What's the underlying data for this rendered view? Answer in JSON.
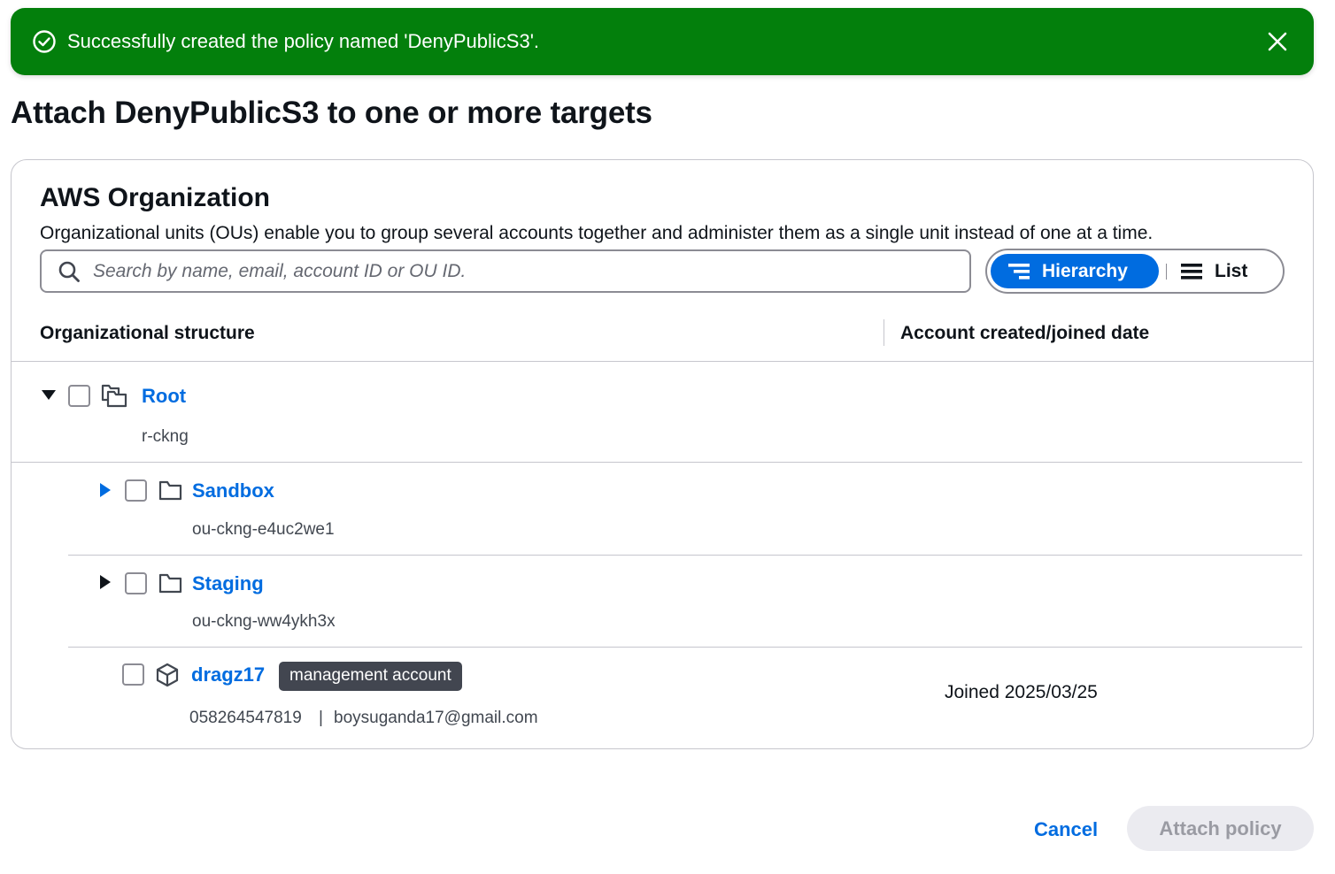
{
  "flash": {
    "message": "Successfully created the policy named 'DenyPublicS3'.",
    "icon": "check-circle-icon",
    "close_icon": "close-icon",
    "color": "#037f0c"
  },
  "page": {
    "title": "Attach DenyPublicS3 to one or more targets"
  },
  "org": {
    "title": "AWS Organization",
    "description": "Organizational units (OUs) enable you to group several accounts together and administer them as a single unit instead of one at a time.",
    "search_placeholder": "Search by name, email, account ID or OU ID.",
    "view_toggle": {
      "hierarchy_label": "Hierarchy",
      "list_label": "List",
      "selected": "Hierarchy"
    },
    "columns": {
      "structure": "Organizational structure",
      "date": "Account created/joined date"
    },
    "nodes": [
      {
        "name": "Root",
        "id": "r-ckng",
        "type": "root",
        "expanded": true
      },
      {
        "name": "Sandbox",
        "id": "ou-ckng-e4uc2we1",
        "type": "ou",
        "expanded": false
      },
      {
        "name": "Staging",
        "id": "ou-ckng-ww4ykh3x",
        "type": "ou",
        "expanded": false
      },
      {
        "name": "dragz17",
        "type": "account",
        "badge": "management account",
        "account_id": "058264547819",
        "separator": "|",
        "email": "boysuganda17@gmail.com",
        "joined": "Joined 2025/03/25"
      }
    ]
  },
  "footer": {
    "cancel_label": "Cancel",
    "attach_label": "Attach policy",
    "attach_enabled": false
  },
  "colors": {
    "link": "#006ce0",
    "toggle_active": "#006ce0",
    "border": "#c6c6cd"
  }
}
